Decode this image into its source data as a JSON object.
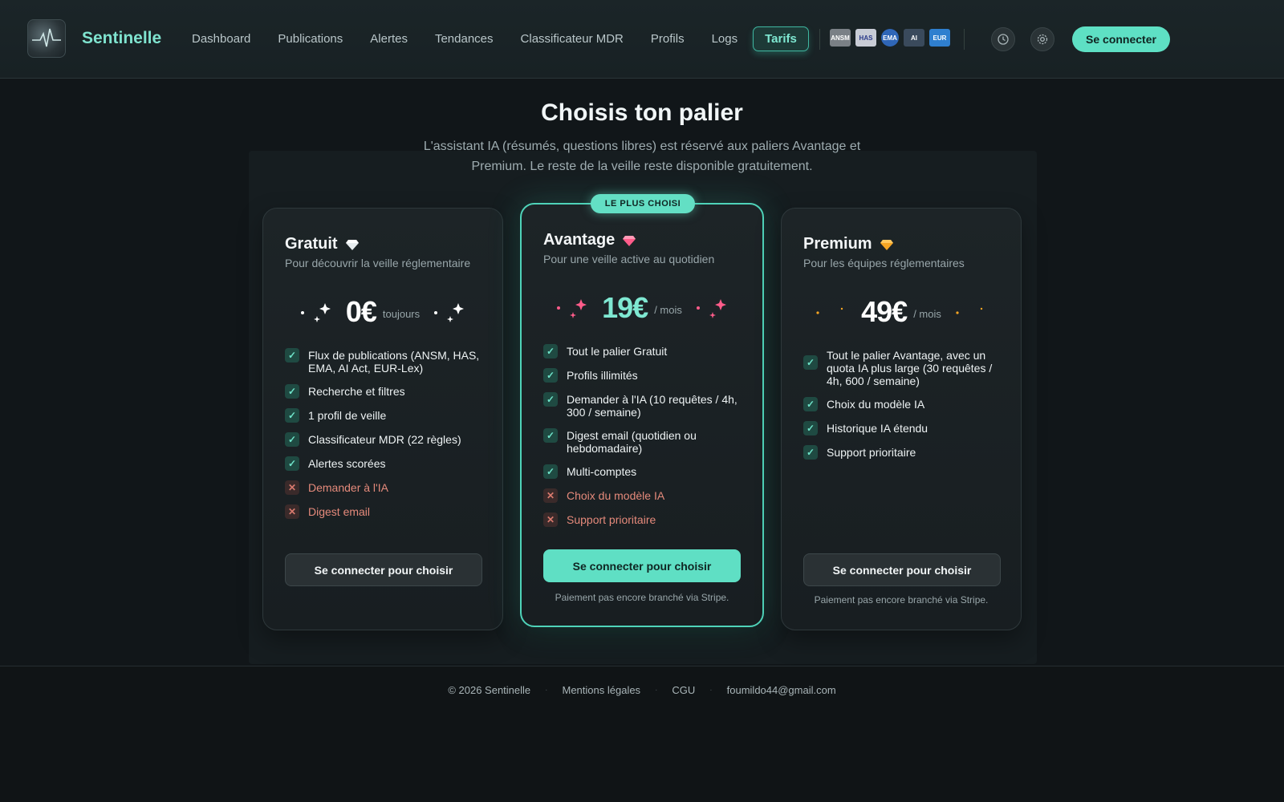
{
  "app": {
    "name": "Sentinelle"
  },
  "nav": {
    "items": [
      {
        "label": "Dashboard"
      },
      {
        "label": "Publications"
      },
      {
        "label": "Alertes"
      },
      {
        "label": "Tendances"
      },
      {
        "label": "Classificateur MDR"
      },
      {
        "label": "Profils"
      },
      {
        "label": "Logs"
      },
      {
        "label": "Tarifs",
        "active": true
      }
    ],
    "login_label": "Se connecter"
  },
  "partners": [
    {
      "label": "ANSM",
      "color": "#7a8086"
    },
    {
      "label": "HAS",
      "color": "#c8ccd6"
    },
    {
      "label": "EMA",
      "color": "#2f66b7"
    },
    {
      "label": "AI",
      "color": "#3a4a5c"
    },
    {
      "label": "EUR",
      "color": "#2f7fcf"
    }
  ],
  "hero": {
    "title": "Choisis ton palier",
    "subtitle": "L'assistant IA (résumés, questions libres) est réservé aux paliers Avantage et Premium. Le reste de la veille reste disponible gratuitement."
  },
  "plans": [
    {
      "name": "Gratuit",
      "gem_color": "#e8eef0",
      "description": "Pour découvrir la veille réglementaire",
      "price": "0€",
      "period": "toujours",
      "sparkle_color": "#ffffff",
      "features": [
        {
          "text": "Flux de publications (ANSM, HAS, EMA, AI Act, EUR-Lex)",
          "included": true
        },
        {
          "text": "Recherche et filtres",
          "included": true
        },
        {
          "text": "1 profil de veille",
          "included": true
        },
        {
          "text": "Classificateur MDR (22 règles)",
          "included": true
        },
        {
          "text": "Alertes scorées",
          "included": true
        },
        {
          "text": "Demander à l'IA",
          "included": false
        },
        {
          "text": "Digest email",
          "included": false
        }
      ],
      "cta": "Se connecter pour choisir",
      "note": ""
    },
    {
      "name": "Avantage",
      "badge": "LE PLUS CHOISI",
      "gem_color": "#ff5c8a",
      "description": "Pour une veille active au quotidien",
      "price": "19€",
      "period": "/ mois",
      "sparkle_color": "#ff5c8a",
      "features": [
        {
          "text": "Tout le palier Gratuit",
          "included": true
        },
        {
          "text": "Profils illimités",
          "included": true
        },
        {
          "text": "Demander à l'IA (10 requêtes / 4h, 300 / semaine)",
          "included": true
        },
        {
          "text": "Digest email (quotidien ou hebdomadaire)",
          "included": true
        },
        {
          "text": "Multi-comptes",
          "included": true
        },
        {
          "text": "Choix du modèle IA",
          "included": false
        },
        {
          "text": "Support prioritaire",
          "included": false
        }
      ],
      "cta": "Se connecter pour choisir",
      "note": "Paiement pas encore branché via Stripe."
    },
    {
      "name": "Premium",
      "gem_color": "#f5a524",
      "description": "Pour les équipes réglementaires",
      "price": "49€",
      "period": "/ mois",
      "sparkle_color": "#f5a524",
      "features": [
        {
          "text": "Tout le palier Avantage, avec un quota IA plus large (30 requêtes / 4h, 600 / semaine)",
          "included": true
        },
        {
          "text": "Choix du modèle IA",
          "included": true
        },
        {
          "text": "Historique IA étendu",
          "included": true
        },
        {
          "text": "Support prioritaire",
          "included": true
        }
      ],
      "cta": "Se connecter pour choisir",
      "note": "Paiement pas encore branché via Stripe."
    }
  ],
  "footer": {
    "copyright": "© 2026 Sentinelle",
    "legal": "Mentions légales",
    "terms": "CGU",
    "email": "foumildo44@gmail.com"
  },
  "colors": {
    "accent": "#5ee0c4",
    "background": "#111619",
    "negative": "#e58a7b"
  }
}
